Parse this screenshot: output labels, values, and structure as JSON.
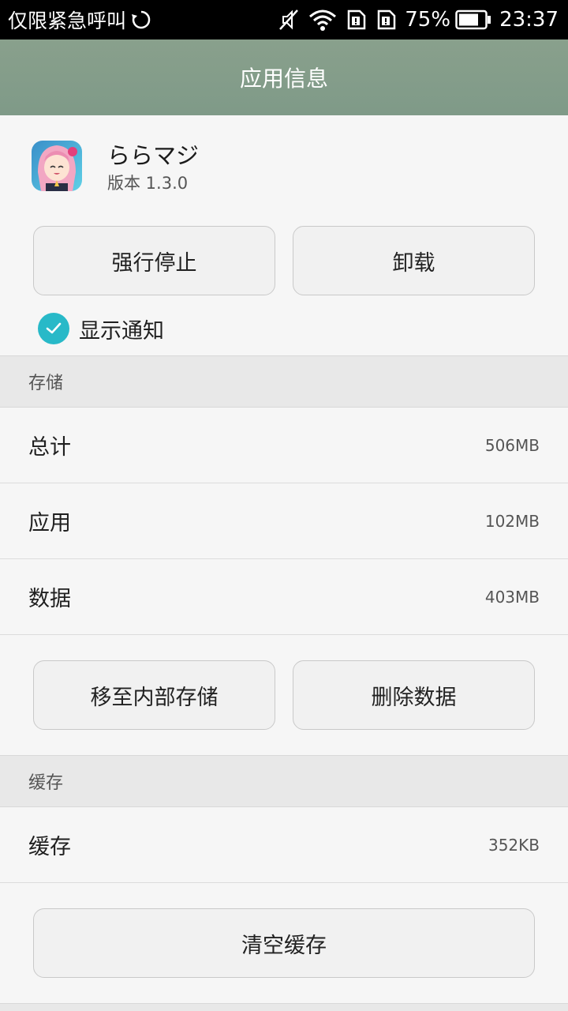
{
  "status_bar": {
    "carrier": "仅限紧急呼叫",
    "battery_percent": "75%",
    "time": "23:37",
    "icons": [
      "sync-icon",
      "mute-icon",
      "wifi-icon",
      "sim1-icon",
      "sim2-icon",
      "battery-icon"
    ]
  },
  "action_bar": {
    "title": "应用信息"
  },
  "app": {
    "name": "ららマジ",
    "version": "版本 1.3.0",
    "force_stop": "强行停止",
    "uninstall": "卸载",
    "show_notifications": "显示通知",
    "show_notifications_checked": true
  },
  "storage": {
    "header": "存储",
    "rows": [
      {
        "label": "总计",
        "value": "506MB"
      },
      {
        "label": "应用",
        "value": "102MB"
      },
      {
        "label": "数据",
        "value": "403MB"
      }
    ],
    "move_button": "移至内部存储",
    "clear_data_button": "删除数据"
  },
  "cache": {
    "header": "缓存",
    "row": {
      "label": "缓存",
      "value": "352KB"
    },
    "clear_cache_button": "清空缓存"
  },
  "colors": {
    "action_bar": "#849d89",
    "checkbox": "#28b9c8",
    "section_bg": "#e8e8e8"
  }
}
